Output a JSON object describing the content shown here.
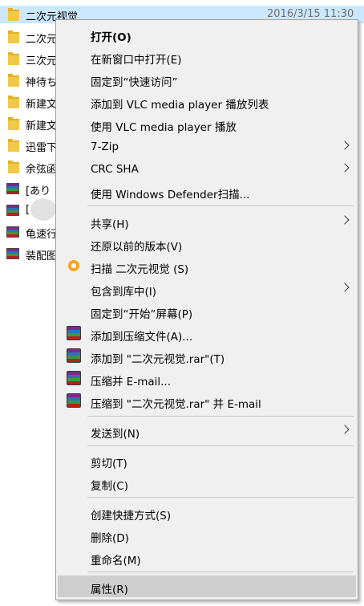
{
  "files": [
    {
      "name": "二次元视觉",
      "date": "2016/3/15 11:30",
      "type": "folder",
      "selected": true
    },
    {
      "name": "二次元",
      "type": "folder"
    },
    {
      "name": "三次元",
      "type": "folder"
    },
    {
      "name": "神待ち",
      "type": "folder"
    },
    {
      "name": "新建文",
      "type": "folder"
    },
    {
      "name": "新建文",
      "type": "folder"
    },
    {
      "name": "迅雷下",
      "type": "folder"
    },
    {
      "name": "余弦函",
      "type": "folder"
    },
    {
      "name": "[あり",
      "type": "rar"
    },
    {
      "name": "[",
      "type": "rar"
    },
    {
      "name": "龟速行",
      "type": "rar"
    },
    {
      "name": "装配图",
      "type": "rar"
    }
  ],
  "context_menu": {
    "items": [
      {
        "label": "打开(O)",
        "bold": true
      },
      {
        "label": "在新窗口中打开(E)"
      },
      {
        "label": "固定到“快速访问”"
      },
      {
        "label": "添加到 VLC media player 播放列表"
      },
      {
        "label": "使用 VLC media player 播放"
      },
      {
        "label": "7-Zip",
        "submenu": true
      },
      {
        "label": "CRC SHA",
        "submenu": true
      },
      {
        "label": "使用 Windows Defender扫描..."
      },
      {
        "label": "共享(H)",
        "submenu": true
      },
      {
        "label": "还原以前的版本(V)"
      },
      {
        "label": "扫描 二次元视觉 (S)",
        "icon": "scan-icon"
      },
      {
        "label": "包含到库中(I)",
        "submenu": true
      },
      {
        "label": "固定到“开始”屏幕(P)"
      },
      {
        "label": "添加到压缩文件(A)...",
        "icon": "winrar-icon"
      },
      {
        "label": "添加到 \"二次元视觉.rar\"(T)",
        "icon": "winrar-icon"
      },
      {
        "label": "压缩并 E-mail...",
        "icon": "winrar-icon"
      },
      {
        "label": "压缩到 \"二次元视觉.rar\" 并 E-mail",
        "icon": "winrar-icon"
      },
      {
        "label": "发送到(N)",
        "submenu": true
      },
      {
        "label": "剪切(T)"
      },
      {
        "label": "复制(C)"
      },
      {
        "label": "创建快捷方式(S)"
      },
      {
        "label": "删除(D)"
      },
      {
        "label": "重命名(M)"
      },
      {
        "label": "属性(R)",
        "highlighted": true
      }
    ]
  },
  "colors": {
    "selection": "#cce8ff",
    "menu_background": "#f0f0f0",
    "menu_highlight": "#cecece",
    "scan_icon": "#f5a623"
  }
}
